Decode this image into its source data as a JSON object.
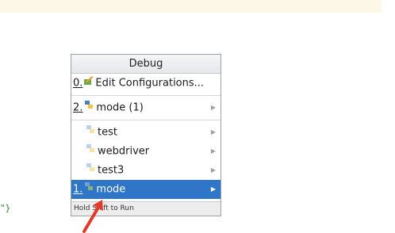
{
  "code_fragment": "\"}",
  "popup": {
    "title": "Debug",
    "edit_item": {
      "mnemonic": "0.",
      "label": "Edit Configurations...",
      "icon": "edit-config-icon"
    },
    "recent_item": {
      "mnemonic": "2.",
      "label": "mode (1)",
      "icon": "python-icon"
    },
    "sub_items": [
      {
        "label": "test",
        "icon": "python-icon-faded"
      },
      {
        "label": "webdriver",
        "icon": "python-icon-faded"
      },
      {
        "label": "test3",
        "icon": "python-icon-faded"
      }
    ],
    "selected_item": {
      "mnemonic": "1.",
      "label": "mode",
      "icon": "python-icon"
    },
    "footer_hint": "Hold Shift to Run"
  },
  "colors": {
    "selection": "#2f76c8",
    "annotation_arrow": "#e03a2a",
    "python_blue": "#4a7fbf",
    "python_yellow": "#f2c53d"
  }
}
